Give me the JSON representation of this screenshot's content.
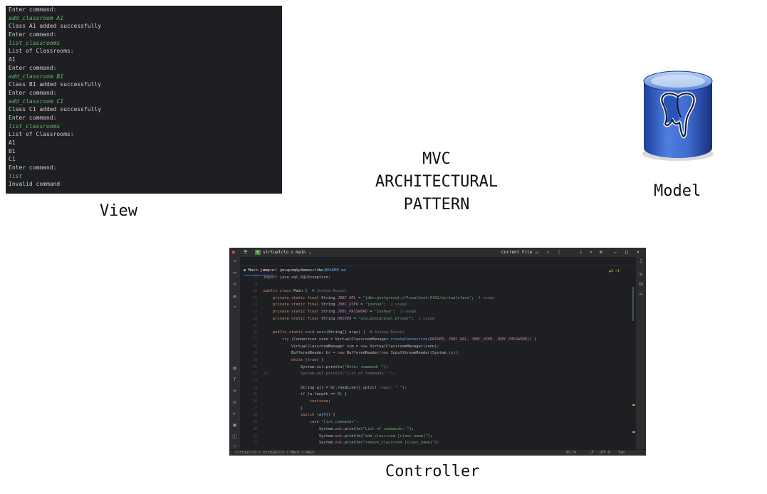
{
  "title_lines": [
    "MVC",
    "ARCHITECTURAL",
    "PATTERN"
  ],
  "labels": {
    "view": "View",
    "model": "Model",
    "controller": "Controller"
  },
  "terminal": {
    "lines": [
      {
        "text": "Enter command:",
        "kind": "out"
      },
      {
        "text": "add_classroom A1",
        "kind": "cmd"
      },
      {
        "text": "Class A1 added successfully",
        "kind": "out"
      },
      {
        "text": "Enter command:",
        "kind": "out"
      },
      {
        "text": "list_classrooms",
        "kind": "cmd"
      },
      {
        "text": "List of Classrooms:",
        "kind": "out"
      },
      {
        "text": "A1",
        "kind": "out"
      },
      {
        "text": "Enter command:",
        "kind": "out"
      },
      {
        "text": "add_classroom B1",
        "kind": "cmd"
      },
      {
        "text": "Class B1 added successfully",
        "kind": "out"
      },
      {
        "text": "Enter command:",
        "kind": "out"
      },
      {
        "text": "add_classroom C1",
        "kind": "cmd"
      },
      {
        "text": "Class C1 added successfully",
        "kind": "out"
      },
      {
        "text": "Enter command:",
        "kind": "out"
      },
      {
        "text": "list_classrooms",
        "kind": "cmd"
      },
      {
        "text": "List of Classrooms:",
        "kind": "out"
      },
      {
        "text": "A1",
        "kind": "out"
      },
      {
        "text": "B1",
        "kind": "out"
      },
      {
        "text": "C1",
        "kind": "out"
      },
      {
        "text": "Enter command:",
        "kind": "out"
      },
      {
        "text": "list",
        "kind": "cmd"
      },
      {
        "text": "Invalid command",
        "kind": "out"
      }
    ]
  },
  "ide": {
    "project": "virtualclo",
    "branch": "main",
    "run_config": "Current File",
    "tabs": [
      "Main.java",
      ".gitignore",
      "README.md"
    ],
    "warnings": "▲3 ✓1",
    "status_bar": {
      "path": "virtualclo > virtualclo > Main > main",
      "position": "36:74",
      "line_sep": "LF",
      "encoding": "UTF-8",
      "indent": "Tab"
    },
    "code": [
      {
        "n": "7",
        "html": "<span class=\"kw\">import</span> java.sql.Connection;"
      },
      {
        "n": "8",
        "html": "<span class=\"kw\">import</span> java.sql.SQLException;"
      },
      {
        "n": "9",
        "html": ""
      },
      {
        "n": "10",
        "html": "<span class=\"kw\">public class</span> Main {  <span class=\"hint\">&#9787; Joshua-Russel</span>"
      },
      {
        "n": "11",
        "html": "    <span class=\"kw\">private static final</span> String <span class=\"fld\">JDBC_URL</span> = <span class=\"st\">\"jdbc:postgresql://localhost:5432/virtualclass\"</span>;  <span class=\"hint\">1 usage</span>"
      },
      {
        "n": "12",
        "html": "    <span class=\"kw\">private static final</span> String <span class=\"fld\">JDBC_USER</span> = <span class=\"st\">\"joshua\"</span>;  <span class=\"hint\">1 usage</span>"
      },
      {
        "n": "13",
        "html": "    <span class=\"kw\">private static final</span> String <span class=\"fld\">JDBC_PASSWORD</span> = <span class=\"st\">\"joshua\"</span>;  <span class=\"hint\">1 usage</span>"
      },
      {
        "n": "14",
        "html": "    <span class=\"kw\">private static final</span> String <span class=\"fld\">DRIVER</span> = <span class=\"st\">\"org.postgresql.Driver\"</span>;  <span class=\"hint\">1 usage</span>"
      },
      {
        "n": "15",
        "html": ""
      },
      {
        "n": "16",
        "html": "    <span class=\"kw\">public static void</span> <span class=\"fn\">main</span>(String[] args) {  <span class=\"hint\">&#9787; Joshua-Russel</span>"
      },
      {
        "n": "17",
        "html": "        <span class=\"kw\">try</span> (Connection conn = VirtualClassroomManager.<span class=\"fn\">createConnection</span>(<span class=\"fld\">DRIVER</span>, <span class=\"fld\">JDBC_URL</span>, <span class=\"fld\">JDBC_USER</span>, <span class=\"fld\">JDBC_PASSWORD</span>)) {"
      },
      {
        "n": "18",
        "html": "            VirtualClassroomManager vcm = <span class=\"kw\">new</span> VirtualClassroomManager(conn);"
      },
      {
        "n": "19",
        "html": "            BufferedReader br = <span class=\"kw\">new</span> BufferedReader(<span class=\"kw\">new</span> InputStreamReader(System.<span class=\"fld\">in</span>));"
      },
      {
        "n": "20",
        "html": "            <span class=\"kw\">while</span> (<span class=\"kw\">true</span>) {"
      },
      {
        "n": "21",
        "html": "                System.<span class=\"fld\">out</span>.println(<span class=\"st\">\"Enter command: \"</span>);"
      },
      {
        "n": "22",
        "html": "<span class=\"cmt\">//</span>              <span class=\"cmt\">System.out.println(\"List of commands: \");</span>"
      },
      {
        "n": "23",
        "html": ""
      },
      {
        "n": "24",
        "html": "                String a[] = br.readLine().split( <span class=\"hint\">regex:</span> <span class=\"st\">\" \"</span>);"
      },
      {
        "n": "25",
        "html": "                <span class=\"kw\">if</span> (a.length == <span class=\"fn\">0</span>) {"
      },
      {
        "n": "26",
        "html": "                    <span class=\"kw\">continue</span>;"
      },
      {
        "n": "27",
        "html": "                }"
      },
      {
        "n": "28",
        "html": "                <span class=\"kw\">switch</span> (a[<span class=\"fn\">0</span>]) {"
      },
      {
        "n": "29",
        "html": "                    <span class=\"kw\">case</span> <span class=\"st\">\"list_commands\"</span>:"
      },
      {
        "n": "30",
        "html": "                        System.<span class=\"fld\">out</span>.println(<span class=\"st\">\"List of commands: \"</span>);"
      },
      {
        "n": "31",
        "html": "                        System.<span class=\"fld\">out</span>.println(<span class=\"st\">\"add_classroom [class_name]\"</span>);"
      },
      {
        "n": "32",
        "html": "                        System.<span class=\"fld\">out</span>.println(<span class=\"st\">\"remove_classroom [class_name]\"</span>);"
      }
    ]
  },
  "colors": {
    "terminal_bg": "#1e1f22",
    "command_green": "#5fb970",
    "ide_panel": "#2b2d30"
  }
}
